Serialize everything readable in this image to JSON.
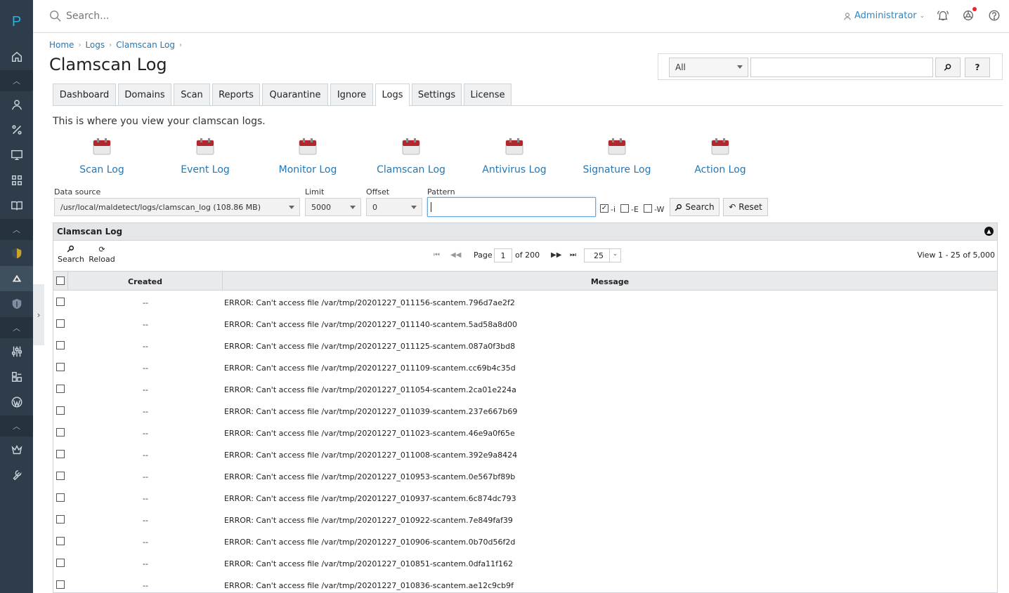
{
  "app": {
    "logo_letter": "P"
  },
  "topbar": {
    "search_placeholder": "Search...",
    "user": "Administrator"
  },
  "breadcrumb": [
    "Home",
    "Logs",
    "Clamscan Log"
  ],
  "page_title": "Clamscan Log",
  "filter": {
    "selected": "All",
    "search_label": "⌕",
    "help_label": "?"
  },
  "tabs": [
    "Dashboard",
    "Domains",
    "Scan",
    "Reports",
    "Quarantine",
    "Ignore",
    "Logs",
    "Settings",
    "License"
  ],
  "active_tab": "Logs",
  "intro": "This is where you view your clamscan logs.",
  "log_links": [
    "Scan Log",
    "Event Log",
    "Monitor Log",
    "Clamscan Log",
    "Antivirus Log",
    "Signature Log",
    "Action Log"
  ],
  "form": {
    "data_source_label": "Data source",
    "data_source_value": "/usr/local/maldetect/logs/clamscan_log (108.86 MB)",
    "limit_label": "Limit",
    "limit_value": "5000",
    "offset_label": "Offset",
    "offset_value": "0",
    "pattern_label": "Pattern",
    "pattern_value": "",
    "opt_i": "-i",
    "opt_e": "-E",
    "opt_w": "-W",
    "search_button": "Search",
    "reset_button": "Reset"
  },
  "grid": {
    "caption": "Clamscan Log",
    "search_label": "Search",
    "reload_label": "Reload",
    "page_label": "Page",
    "page_value": "1",
    "of_label": "of 200",
    "rows_per_page": "25",
    "view_text": "View 1 - 25 of 5,000",
    "columns": [
      "Created",
      "Message"
    ],
    "rows": [
      {
        "created": "--",
        "message": "ERROR: Can't access file /var/tmp/20201227_011156-scantem.796d7ae2f2"
      },
      {
        "created": "--",
        "message": "ERROR: Can't access file /var/tmp/20201227_011140-scantem.5ad58a8d00"
      },
      {
        "created": "--",
        "message": "ERROR: Can't access file /var/tmp/20201227_011125-scantem.087a0f3bd8"
      },
      {
        "created": "--",
        "message": "ERROR: Can't access file /var/tmp/20201227_011109-scantem.cc69b4c35d"
      },
      {
        "created": "--",
        "message": "ERROR: Can't access file /var/tmp/20201227_011054-scantem.2ca01e224a"
      },
      {
        "created": "--",
        "message": "ERROR: Can't access file /var/tmp/20201227_011039-scantem.237e667b69"
      },
      {
        "created": "--",
        "message": "ERROR: Can't access file /var/tmp/20201227_011023-scantem.46e9a0f65e"
      },
      {
        "created": "--",
        "message": "ERROR: Can't access file /var/tmp/20201227_011008-scantem.392e9a8424"
      },
      {
        "created": "--",
        "message": "ERROR: Can't access file /var/tmp/20201227_010953-scantem.0e567bf89b"
      },
      {
        "created": "--",
        "message": "ERROR: Can't access file /var/tmp/20201227_010937-scantem.6c874dc793"
      },
      {
        "created": "--",
        "message": "ERROR: Can't access file /var/tmp/20201227_010922-scantem.7e849faf39"
      },
      {
        "created": "--",
        "message": "ERROR: Can't access file /var/tmp/20201227_010906-scantem.0b70d56f2d"
      },
      {
        "created": "--",
        "message": "ERROR: Can't access file /var/tmp/20201227_010851-scantem.0dfa11f162"
      },
      {
        "created": "--",
        "message": "ERROR: Can't access file /var/tmp/20201227_010836-scantem.ae12c9cb9f"
      }
    ]
  },
  "colors": {
    "rail": "#2f3d4a",
    "link": "#2478b5",
    "accent": "#26b2e6"
  }
}
